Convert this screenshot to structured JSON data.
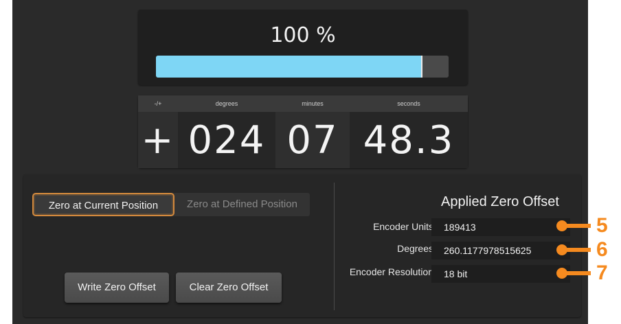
{
  "progress": {
    "label": "100 %",
    "fraction": 0.905
  },
  "coordinate": {
    "headers": {
      "sign": "-/+",
      "degrees": "degrees",
      "minutes": "minutes",
      "seconds": "seconds"
    },
    "values": {
      "sign": "+",
      "degrees": "024",
      "minutes": "07",
      "seconds": "48.3"
    }
  },
  "zero_mode": {
    "current": "Zero at Current Position",
    "defined": "Zero at Defined Position"
  },
  "buttons": {
    "write": "Write Zero Offset",
    "clear": "Clear Zero Offset"
  },
  "applied_offset": {
    "title": "Applied Zero Offset",
    "rows": [
      {
        "label": "Encoder Units",
        "value": "189413"
      },
      {
        "label": "Degrees",
        "value": "260.1177978515625"
      },
      {
        "label": "Encoder Resolution",
        "value": "18 bit"
      }
    ]
  },
  "callouts": [
    "5",
    "6",
    "7"
  ],
  "colors": {
    "accent": "#f58a1f",
    "progress": "#7ed6f5",
    "active_border": "#d48a3d"
  }
}
